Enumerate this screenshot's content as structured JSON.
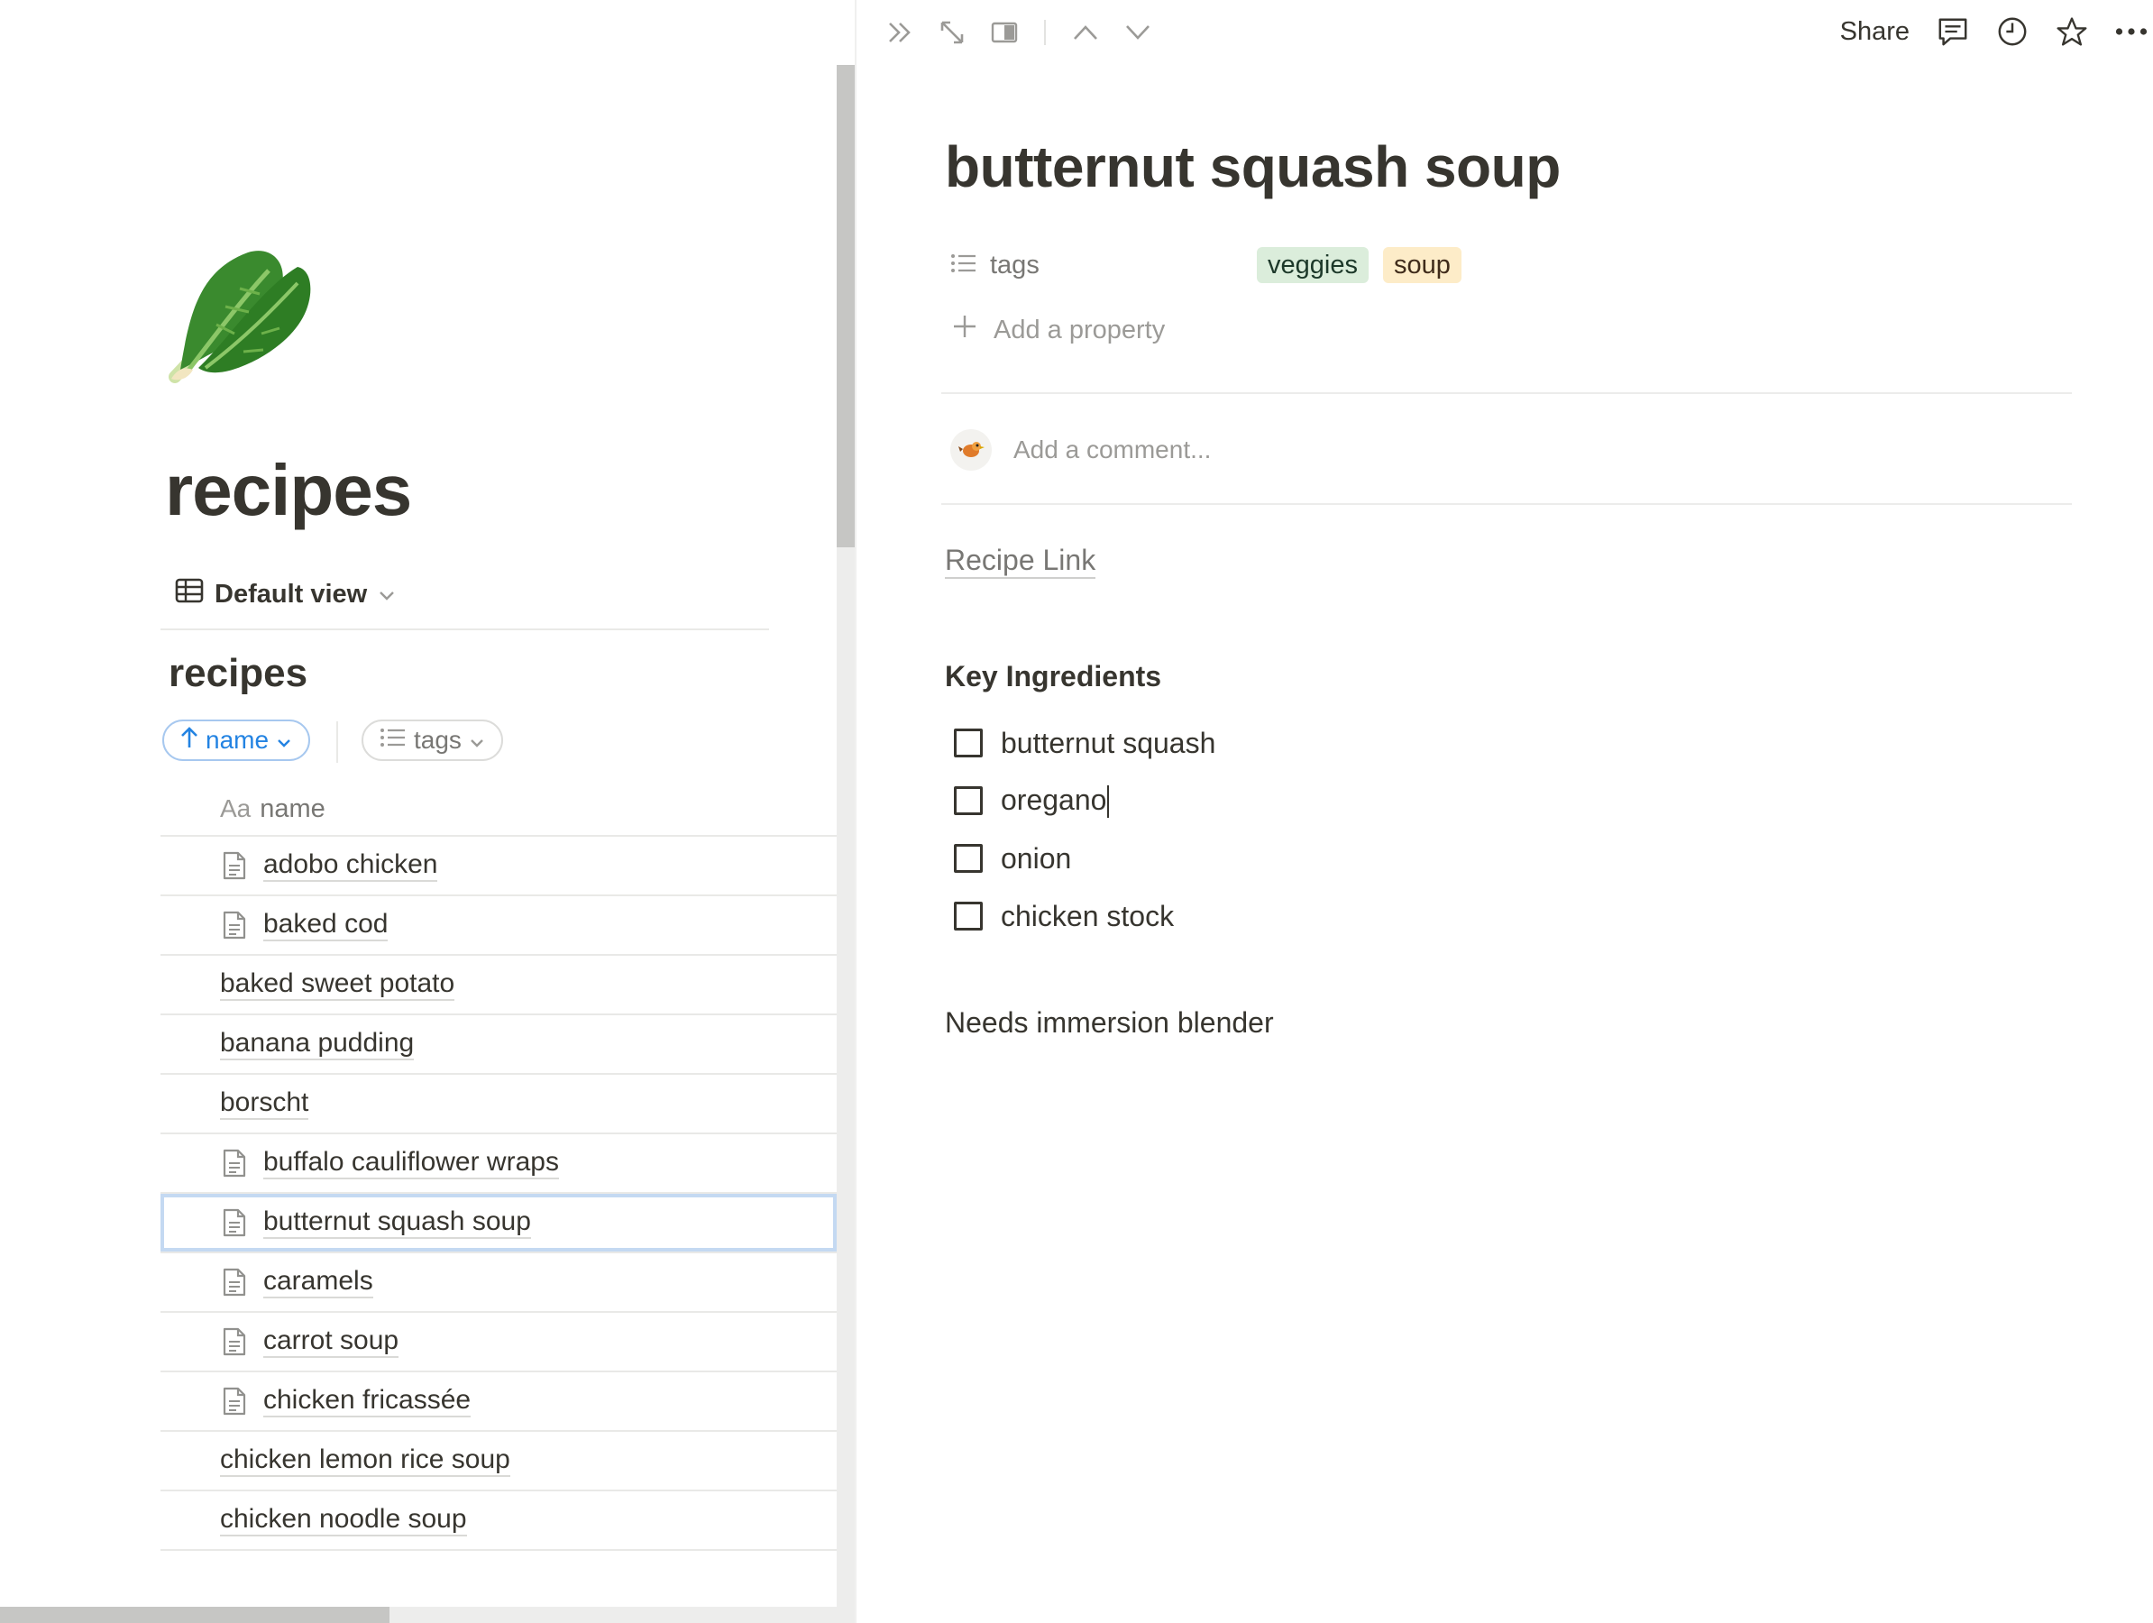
{
  "left": {
    "page_title": "recipes",
    "view_label": "Default view",
    "database_title": "recipes",
    "sort_chip": "name",
    "tags_chip": "tags",
    "column_prefix": "Aa",
    "column_name": "name",
    "rows": [
      {
        "label": "adobo chicken",
        "icon": true
      },
      {
        "label": "baked cod",
        "icon": true
      },
      {
        "label": "baked sweet potato",
        "icon": false
      },
      {
        "label": "banana pudding",
        "icon": false
      },
      {
        "label": "borscht",
        "icon": false
      },
      {
        "label": "buffalo cauliflower wraps",
        "icon": true
      },
      {
        "label": "butternut squash soup",
        "icon": true,
        "selected": true
      },
      {
        "label": "caramels",
        "icon": true
      },
      {
        "label": "carrot soup",
        "icon": true
      },
      {
        "label": "chicken fricassée",
        "icon": true
      },
      {
        "label": "chicken lemon rice soup",
        "icon": false
      },
      {
        "label": "chicken noodle soup",
        "icon": false
      }
    ]
  },
  "topbar": {
    "share_label": "Share",
    "icons": [
      "double-chevron-right-icon",
      "expand-icon",
      "side-peek-icon",
      "chevron-up-icon",
      "chevron-down-icon",
      "comment-icon",
      "clock-icon",
      "star-icon",
      "more-icon"
    ]
  },
  "doc": {
    "title": "butternut squash soup",
    "tags_property_label": "tags",
    "tags": [
      {
        "label": "veggies",
        "bg": "#dbeddb",
        "fg": "#1c3829"
      },
      {
        "label": "soup",
        "bg": "#fdecc8",
        "fg": "#402c1b"
      }
    ],
    "add_property_label": "Add a property",
    "comment_placeholder": "Add a comment...",
    "recipe_link": "Recipe Link",
    "ingredients_heading": "Key Ingredients",
    "ingredients": [
      "butternut squash",
      "oregano",
      "onion",
      "chicken stock"
    ],
    "notes": "Needs immersion blender"
  },
  "colors": {
    "accent": "#2383e2",
    "text": "#37352f",
    "muted": "#787774",
    "divider": "#e9e9e7"
  }
}
